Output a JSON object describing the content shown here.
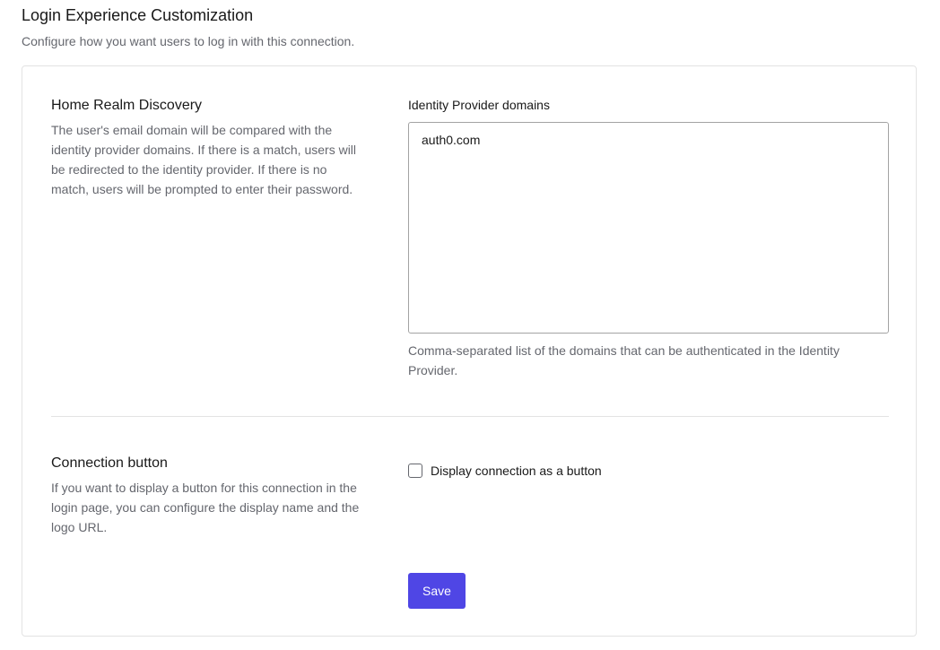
{
  "header": {
    "title": "Login Experience Customization",
    "subtitle": "Configure how you want users to log in with this connection."
  },
  "home_realm": {
    "title": "Home Realm Discovery",
    "description": "The user's email domain will be compared with the identity provider domains. If there is a match, users will be redirected to the identity provider. If there is no match, users will be prompted to enter their password.",
    "field_label": "Identity Provider domains",
    "field_value": "auth0.com",
    "help_text": "Comma-separated list of the domains that can be authenticated in the Identity Provider."
  },
  "connection_button": {
    "title": "Connection button",
    "description": "If you want to display a button for this connection in the login page, you can configure the display name and the logo URL.",
    "checkbox_label": "Display connection as a button",
    "checkbox_checked": false
  },
  "actions": {
    "save_label": "Save"
  },
  "colors": {
    "primary": "#4f46e5",
    "text": "#191919",
    "muted_text": "#65676e",
    "border": "#e3e3e3"
  }
}
